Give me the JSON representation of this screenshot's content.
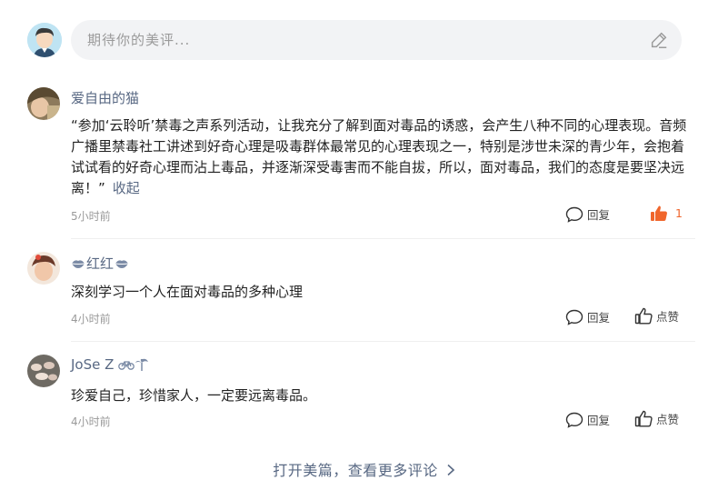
{
  "composer": {
    "placeholder": "期待你的美评..."
  },
  "comments": [
    {
      "name": "爱自由的猫",
      "text": "“参加‘云聆听’禁毒之声系列活动，让我充分了解到面对毒品的诱惑，会产生八种不同的心理表现。音频广播里禁毒社工讲述到好奇心理是吸毒群体最常见的心理表现之一，特别是涉世未深的青少年，会抱着试试看的好奇心理而沾上毒品，并逐渐深受毒害而不能自拔，所以，面对毒品，我们的态度是要坚决远离！”",
      "collapse_label": "收起",
      "time": "5小时前",
      "reply_label": "回复",
      "like_label": "1",
      "liked": true
    },
    {
      "name": "红红",
      "text": "深刻学习一个人在面对毒品的多种心理",
      "time": "4小时前",
      "reply_label": "回复",
      "like_label": "点赞",
      "liked": false
    },
    {
      "name": "JoSe Z",
      "text": "珍爱自己，珍惜家人，一定要远离毒品。",
      "time": "4小时前",
      "reply_label": "回复",
      "like_label": "点赞",
      "liked": false
    }
  ],
  "footer": {
    "more_label": "打开美篇，查看更多评论"
  },
  "colors": {
    "link": "#586883",
    "like_active": "#f0662c"
  }
}
